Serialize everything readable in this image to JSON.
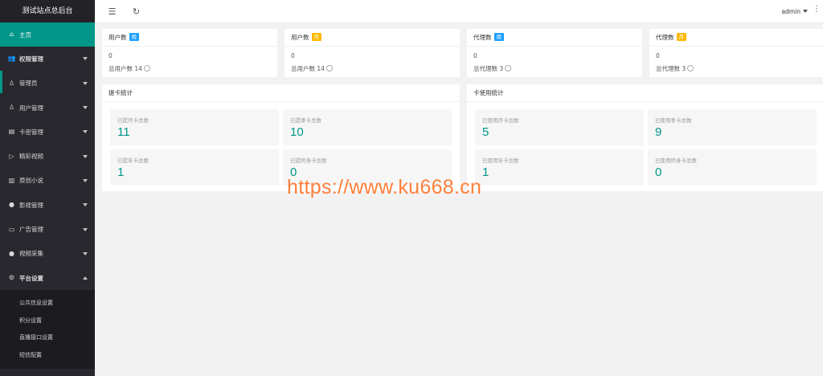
{
  "sidebar": {
    "brand": "测试站点总后台",
    "items": [
      {
        "label": "主页",
        "icon": "home-icon",
        "glyph": "⌂"
      },
      {
        "label": "权限管理",
        "icon": "users-icon",
        "glyph": "👥"
      },
      {
        "label": "管理员",
        "icon": "user-icon",
        "glyph": "♙"
      },
      {
        "label": "用户管理",
        "icon": "user-group-icon",
        "glyph": "♙"
      },
      {
        "label": "卡密管理",
        "icon": "card-icon",
        "glyph": "▤"
      },
      {
        "label": "精彩视频",
        "icon": "play-icon",
        "glyph": "▷"
      },
      {
        "label": "原创小说",
        "icon": "book-icon",
        "glyph": "▥"
      },
      {
        "label": "影视管理",
        "icon": "film-icon",
        "glyph": "●"
      },
      {
        "label": "广告管理",
        "icon": "ad-icon",
        "glyph": "▭"
      },
      {
        "label": "视频采集",
        "icon": "collect-icon",
        "glyph": "●"
      },
      {
        "label": "平台设置",
        "icon": "gear-icon",
        "glyph": "⚙"
      }
    ],
    "sub_items": [
      {
        "label": "公共信息设置"
      },
      {
        "label": "积分设置"
      },
      {
        "label": "直播接口设置"
      },
      {
        "label": "短信配置"
      }
    ]
  },
  "header": {
    "menu_icon": "☰",
    "refresh_icon": "↻",
    "user": "admin",
    "more_icon": "⋮"
  },
  "cards": [
    {
      "title": "用户数",
      "badge": "周",
      "badge_color": "#1e9fff",
      "value": "0",
      "total_label": "总用户数",
      "total": "14"
    },
    {
      "title": "用户数",
      "badge": "月",
      "badge_color": "#ffb800",
      "value": "0",
      "total_label": "总用户数",
      "total": "14"
    },
    {
      "title": "代理数",
      "badge": "周",
      "badge_color": "#1e9fff",
      "value": "0",
      "total_label": "总代理数",
      "total": "3"
    },
    {
      "title": "代理数",
      "badge": "月",
      "badge_color": "#ffb800",
      "value": "0",
      "total_label": "总代理数",
      "total": "3"
    }
  ],
  "panels": [
    {
      "title": "提卡统计",
      "tiles": [
        {
          "label": "已提月卡总数",
          "value": "11"
        },
        {
          "label": "已提季卡总数",
          "value": "10"
        },
        {
          "label": "已提年卡总数",
          "value": "1"
        },
        {
          "label": "已提终身卡总数",
          "value": "0"
        }
      ]
    },
    {
      "title": "卡使用统计",
      "tiles": [
        {
          "label": "已使用月卡总数",
          "value": "5"
        },
        {
          "label": "已使用季卡总数",
          "value": "9"
        },
        {
          "label": "已使用年卡总数",
          "value": "1"
        },
        {
          "label": "已使用终身卡总数",
          "value": "0"
        }
      ]
    }
  ],
  "watermark": "https://www.ku668.cn",
  "colors": {
    "accent": "#009688",
    "sidebar": "#28282e",
    "badge_blue": "#1e9fff",
    "badge_orange": "#ffb800"
  }
}
